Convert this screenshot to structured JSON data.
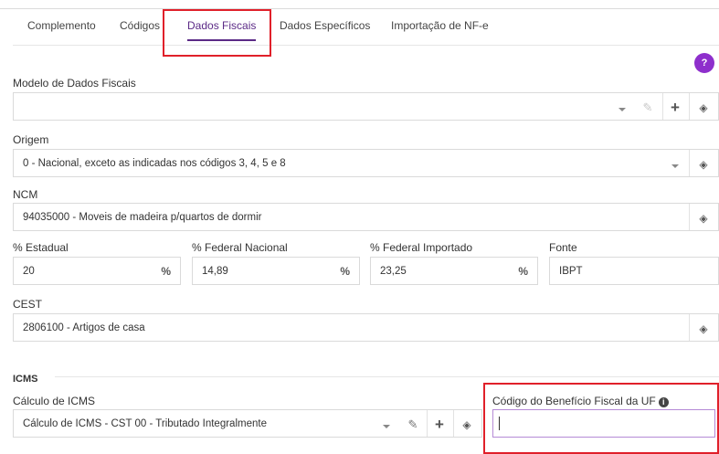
{
  "tabs": [
    {
      "label": "Complemento"
    },
    {
      "label": "Códigos"
    },
    {
      "label": "Dados Fiscais",
      "active": true
    },
    {
      "label": "Dados Específicos"
    },
    {
      "label": "Importação de NF-e"
    }
  ],
  "help_label": "?",
  "modelo": {
    "label": "Modelo de Dados Fiscais",
    "value": ""
  },
  "origem": {
    "label": "Origem",
    "value": "0 - Nacional, exceto as indicadas nos códigos 3, 4, 5 e 8"
  },
  "ncm": {
    "label": "NCM",
    "value": "94035000 - Moveis de madeira p/quartos de dormir"
  },
  "estadual": {
    "label": "% Estadual",
    "value": "20",
    "suffix": "%"
  },
  "federal_nacional": {
    "label": "% Federal Nacional",
    "value": "14,89",
    "suffix": "%"
  },
  "federal_importado": {
    "label": "% Federal Importado",
    "value": "23,25",
    "suffix": "%"
  },
  "fonte": {
    "label": "Fonte",
    "value": "IBPT"
  },
  "cest": {
    "label": "CEST",
    "value": "2806100 - Artigos de casa"
  },
  "icms": {
    "section_title": "ICMS",
    "calculo_label": "Cálculo de ICMS",
    "calculo_value": "Cálculo de ICMS - CST 00 - Tributado Integralmente",
    "beneficio_label": "Código do Benefício Fiscal da UF",
    "beneficio_value": ""
  },
  "icons": {
    "caret": "chevron-down-icon",
    "edit": "pencil-icon",
    "add": "plus-icon",
    "clear": "eraser-icon",
    "info": "info-icon"
  },
  "colors": {
    "accent": "#5b2a86",
    "help_button": "#8e2fcc",
    "highlight": "#e0202a",
    "focus_border": "#b58ad6"
  }
}
